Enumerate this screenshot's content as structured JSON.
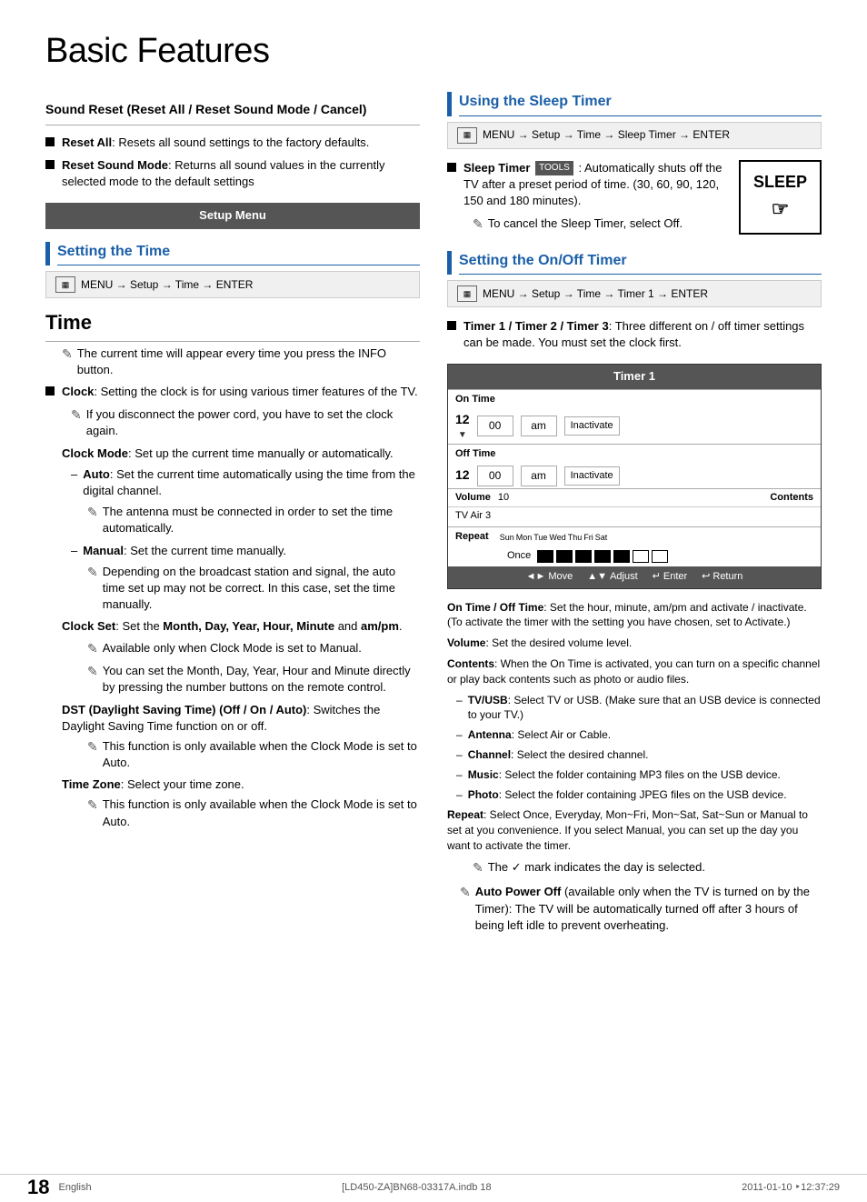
{
  "page": {
    "main_title": "Basic Features",
    "page_number": "18",
    "lang_label": "English",
    "footer_left": "[LD450-ZA]BN68-03317A.indb   18",
    "footer_right": "2011-01-10   ‣12:37:29"
  },
  "left_col": {
    "sound_reset": {
      "title": "Sound Reset (Reset All / Reset Sound Mode / Cancel)",
      "bullet1_bold": "Reset All",
      "bullet1_text": ": Resets all sound settings to the factory defaults.",
      "bullet2_bold": "Reset Sound Mode",
      "bullet2_text": ": Returns all sound values in the currently selected mode to the default settings"
    },
    "setup_menu": {
      "label": "Setup Menu"
    },
    "setting_time": {
      "title": "Setting the Time",
      "menu_path": "MENU  → Setup → Time → ENTER"
    },
    "time": {
      "title": "Time",
      "note1": "The current time will appear every time you press the INFO button.",
      "bullet_clock_bold": "Clock",
      "bullet_clock_text": ": Setting the clock is for using various timer features of the TV.",
      "note_disconnect": "If you disconnect the power cord, you have to set the clock again.",
      "clock_mode_bold": "Clock Mode",
      "clock_mode_text": ": Set up the current time manually or automatically.",
      "auto_bold": "Auto",
      "auto_text": ": Set the current time automatically using the time from the digital channel.",
      "note_antenna": "The antenna must be connected in order to set the time automatically.",
      "manual_bold": "Manual",
      "manual_text": ": Set the current time manually.",
      "note_broadcast": "Depending on the broadcast station and signal, the auto time set up may not be correct. In this case, set the time manually.",
      "clock_set_bold": "Clock Set",
      "clock_set_text": ": Set the ",
      "clock_set_items": "Month, Day, Year, Hour, Minute",
      "clock_set_and": " and ",
      "clock_set_ampm": "am/pm",
      "note_available": "Available only when Clock Mode is set to Manual.",
      "note_month": "You can set the Month, Day, Year, Hour and Minute  directly by pressing the number buttons on the remote control.",
      "dst_bold": "DST (Daylight Saving Time) (Off / On / Auto)",
      "dst_text": ":\nSwitches the Daylight Saving Time function on or off.",
      "note_dst": "This function is only available when the Clock Mode is set to Auto.",
      "timezone_bold": "Time Zone",
      "timezone_text": ": Select your time zone.",
      "note_timezone": "This function is only available when the Clock Mode is set to Auto."
    }
  },
  "right_col": {
    "sleep_timer": {
      "title": "Using the Sleep Timer",
      "menu_path": "MENU  → Setup → Time → Sleep Timer → ENTER",
      "bullet_bold": "Sleep Timer",
      "tools_label": "TOOLS",
      "bullet_text": ": Automatically shuts off the TV after a preset period of time. (30, 60, 90, 120, 150 and 180 minutes).",
      "note_cancel": "To cancel the Sleep Timer, select Off.",
      "sleep_display": "SLEEP"
    },
    "on_off_timer": {
      "title": "Setting the On/Off Timer",
      "menu_path": "MENU  → Setup → Time → Timer 1 → ENTER",
      "bullet_bold": "Timer 1 / Timer 2 / Timer 3",
      "bullet_text": ": Three different on / off timer settings can be made. You must set the clock first.",
      "timer_table": {
        "title": "Timer 1",
        "on_time_label": "On Time",
        "on_time_hour": "12",
        "on_time_min": "00",
        "on_time_ampm": "am",
        "on_time_status": "Inactivate",
        "off_time_label": "Off Time",
        "off_time_hour": "12",
        "off_time_min": "00",
        "off_time_ampm": "am",
        "off_time_status": "Inactivate",
        "volume_label": "Volume",
        "volume_val": "10",
        "contents_label": "Contents",
        "contents_val": "TV  Air  3",
        "repeat_label": "Repeat",
        "repeat_val": "Once",
        "days": [
          "Sun",
          "Mon",
          "Tue",
          "Wed",
          "Thu",
          "Fri",
          "Sat"
        ],
        "nav_move": "Move",
        "nav_adjust": "Adjust",
        "nav_enter": "Enter",
        "nav_return": "Return"
      },
      "on_off_time_bold": "On Time / Off Time",
      "on_off_time_text": ": Set the hour, minute, am/pm and activate / inactivate. (To activate the timer with the setting you have chosen, set to Activate.)",
      "volume_bold": "Volume",
      "volume_text": ": Set the desired volume level.",
      "contents_bold": "Contents",
      "contents_text": ": When the On Time is activated, you can turn on a specific channel or play back contents such as photo or audio files.",
      "dash_tvusb_bold": "TV/USB",
      "dash_tvusb_text": ": Select TV or USB. (Make sure that an USB device is connected to your TV.)",
      "dash_antenna_bold": "Antenna",
      "dash_antenna_text": ": Select Air or Cable.",
      "dash_channel_bold": "Channel",
      "dash_channel_text": ": Select the desired channel.",
      "dash_music_bold": "Music",
      "dash_music_text": ": Select the folder containing MP3 files on the USB device.",
      "dash_photo_bold": "Photo",
      "dash_photo_text": ": Select the folder containing JPEG files on the USB device.",
      "repeat_bold": "Repeat",
      "repeat_text": ": Select Once, Everyday, Mon~Fri, Mon~Sat, Sat~Sun or Manual to set at you convenience. If you select Manual, you can set up the day you want to activate the timer.",
      "note_check": "The ✓ mark indicates the day is selected.",
      "note_autopower_bold": "Auto Power Off",
      "note_autopower_text": " (available only when the TV is turned on by the Timer): The TV will be automatically turned off after 3 hours of being left idle to prevent overheating."
    }
  }
}
